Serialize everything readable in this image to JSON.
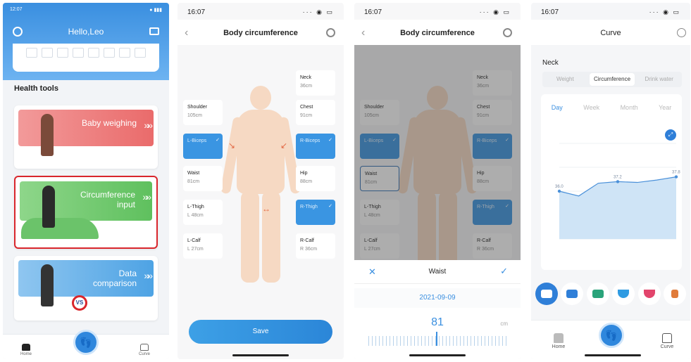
{
  "phone1": {
    "status_time": "12:07",
    "greeting": "Hello,Leo",
    "section_title": "Health tools",
    "tools": [
      {
        "label_line1": "Baby weighing",
        "label_line2": ""
      },
      {
        "label_line1": "Circumference",
        "label_line2": "input"
      },
      {
        "label_line1": "Data",
        "label_line2": "comparison"
      }
    ],
    "vs_badge": "VS",
    "tabs": {
      "home": "Home",
      "curve": "Curve"
    }
  },
  "phone2": {
    "status_time": "16:07",
    "title": "Body circumference",
    "measurements": [
      {
        "key": "neck",
        "name": "Neck",
        "value": "36cm"
      },
      {
        "key": "shoulder",
        "name": "Shoulder",
        "value": "105cm"
      },
      {
        "key": "chest",
        "name": "Chest",
        "value": "91cm"
      },
      {
        "key": "lbiceps",
        "name": "L-Biceps",
        "value": ""
      },
      {
        "key": "rbiceps",
        "name": "R-Biceps",
        "value": ""
      },
      {
        "key": "waist",
        "name": "Waist",
        "value": "81cm"
      },
      {
        "key": "hip",
        "name": "Hip",
        "value": "88cm"
      },
      {
        "key": "lthigh",
        "name": "L-Thigh",
        "value": "L 48cm"
      },
      {
        "key": "rthigh",
        "name": "R-Thigh",
        "value": ""
      },
      {
        "key": "lcalf",
        "name": "L-Calf",
        "value": "L 27cm"
      },
      {
        "key": "rcalf",
        "name": "R-Calf",
        "value": "R 36cm"
      }
    ],
    "save_label": "Save"
  },
  "phone3": {
    "status_time": "16:07",
    "title": "Body circumference",
    "sheet": {
      "title": "Waist",
      "date": "2021-09-09",
      "value": "81",
      "unit": "cm"
    }
  },
  "phone4": {
    "status_time": "16:07",
    "title": "Curve",
    "metric": "Neck",
    "segments": [
      "Weight",
      "Circumference",
      "Drink water"
    ],
    "periods": [
      "Day",
      "Week",
      "Month",
      "Year"
    ],
    "tabs": {
      "home": "Home",
      "curve": "Curve"
    }
  },
  "chart_data": {
    "type": "area",
    "title": "",
    "xlabel": "",
    "ylabel": "",
    "x": [
      "",
      "",
      "",
      "",
      "",
      "",
      ""
    ],
    "series": [
      {
        "values": [
          36.0,
          35.4,
          37.0,
          37.2,
          37.1,
          37.4,
          37.8
        ]
      }
    ],
    "point_labels": [
      "36.0",
      "",
      "",
      "37.2",
      "",
      "",
      "37.8"
    ],
    "y_ticks": [
      "",
      "",
      "",
      "",
      ""
    ],
    "ylim": [
      30,
      42
    ],
    "grid": true,
    "fill_color": "#cfe4f6",
    "line_color": "#4a90d9"
  }
}
